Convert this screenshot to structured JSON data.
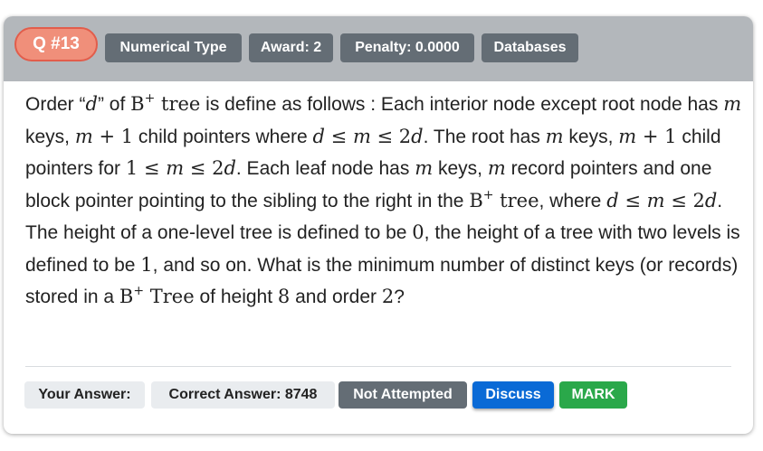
{
  "header": {
    "question_number": "Q #13",
    "tags": [
      "Numerical Type",
      "Award: 2",
      "Penalty: 0.0000",
      "Databases"
    ]
  },
  "question": {
    "t01": "Order “",
    "t02": "d",
    "t03": "” of ",
    "t04": "B",
    "t05": "+",
    "t06": " tree",
    "t07": " is define as follows : Each interior node except root node has ",
    "t08": "m",
    "t09": " keys, ",
    "t10": "m",
    "t11": " + 1",
    "t12": " child pointers where ",
    "t13": "d",
    "t14": " ≤ ",
    "t15": "m",
    "t16": " ≤ 2",
    "t17": "d",
    "t18": ". The root has ",
    "t19": "m",
    "t20": " keys, ",
    "t21": "m",
    "t22": " + 1",
    "t23": " child pointers for ",
    "t24": "1 ≤ ",
    "t25": "m",
    "t26": " ≤ 2",
    "t27": "d",
    "t28": ". Each leaf node has ",
    "t29": "m",
    "t30": " keys, ",
    "t31": "m",
    "t32": " record pointers and one block pointer pointing to the sibling to the right in the ",
    "t33": "B",
    "t34": "+",
    "t35": " tree",
    "t36": ", where ",
    "t37": "d",
    "t38": " ≤ ",
    "t39": "m",
    "t40": " ≤ 2",
    "t41": "d",
    "t42": ". The height of a one-level tree is defined to be ",
    "t43": "0",
    "t44": ", the height of a tree with two levels is defined to be ",
    "t45": "1",
    "t46": ", and so on. What is the minimum number of distinct keys (or records) stored in a ",
    "t47": "B",
    "t48": "+",
    "t49": " Tree",
    "t50": " of height ",
    "t51": "8",
    "t52": " and order ",
    "t53": "2",
    "t54": "?"
  },
  "footer": {
    "your_answer": "Your Answer:",
    "correct_answer": "Correct Answer: 8748",
    "status": "Not Attempted",
    "discuss": "Discuss",
    "mark": "MARK"
  },
  "colors": {
    "header_bg": "#b3b7bb",
    "qnum_bg": "#f08f7a",
    "tag_bg": "#646d75",
    "discuss_bg": "#0a6ad6",
    "mark_bg": "#2aa84a"
  }
}
